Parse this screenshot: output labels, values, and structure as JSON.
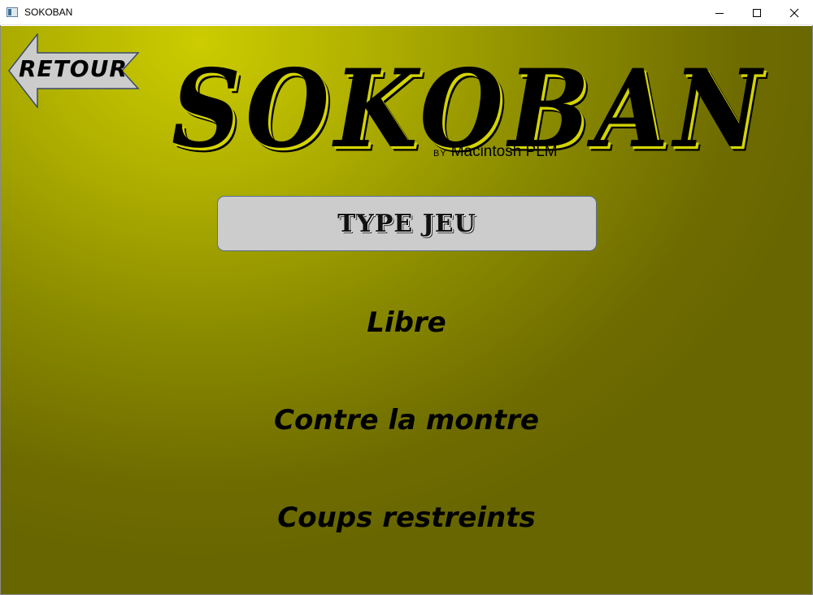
{
  "window": {
    "title": "SOKOBAN",
    "controls": [
      "minimize-icon",
      "maximize-icon",
      "close-icon"
    ]
  },
  "colors": {
    "background_light": "#cccc00",
    "background_dark": "#686600",
    "box_fill": "#cccccc",
    "box_border": "#5b6f95",
    "arrow_fill": "#cccccc"
  },
  "nav": {
    "back_label": "RETOUR",
    "back_icon": "left-arrow-icon"
  },
  "header": {
    "logo": "SOKOBAN",
    "by": "BY",
    "author": "Macintosh PLM"
  },
  "section": {
    "title": "TYPE JEU"
  },
  "menu": {
    "options": [
      "Libre",
      "Contre la montre",
      "Coups restreints"
    ]
  }
}
